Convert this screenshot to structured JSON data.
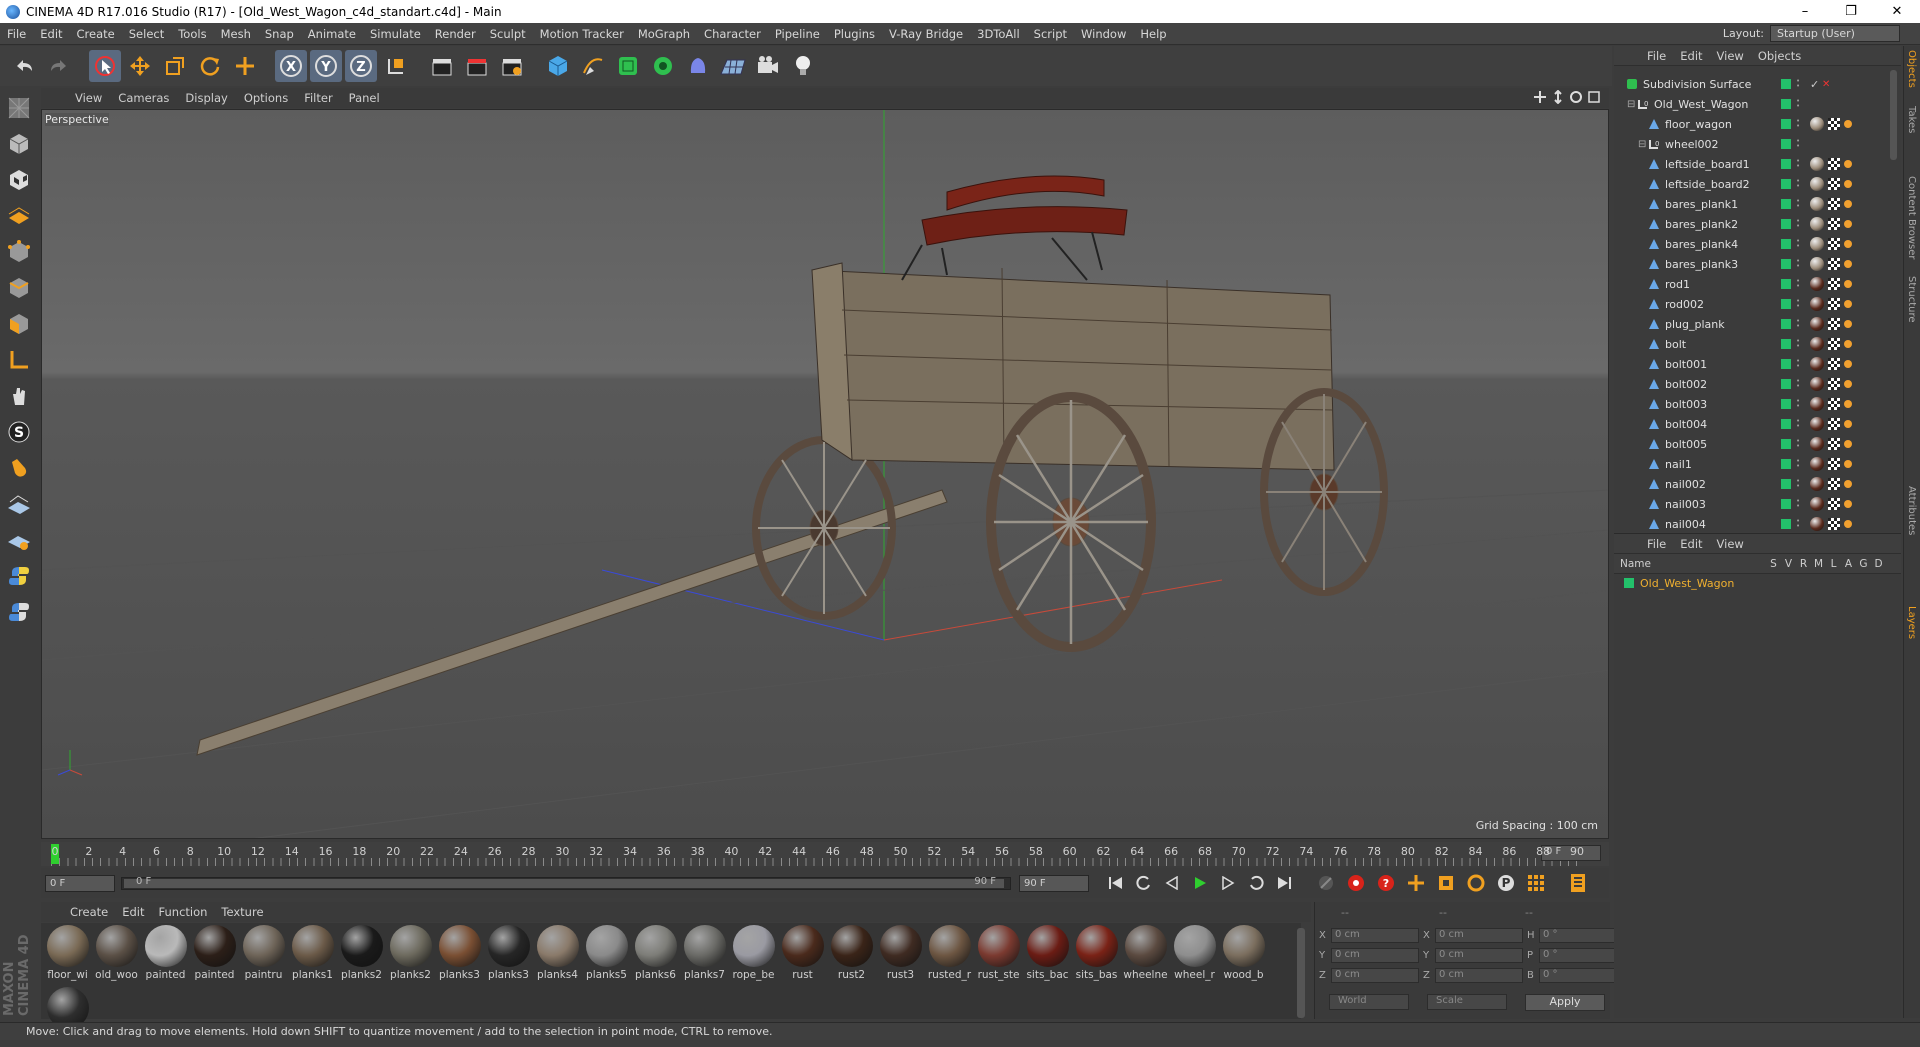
{
  "window": {
    "title": "CINEMA 4D R17.016 Studio (R17) - [Old_West_Wagon_c4d_standart.c4d] - Main",
    "minimize": "–",
    "restore": "❐",
    "close": "✕"
  },
  "menu": [
    "File",
    "Edit",
    "Create",
    "Select",
    "Tools",
    "Mesh",
    "Snap",
    "Animate",
    "Simulate",
    "Render",
    "Sculpt",
    "Motion Tracker",
    "MoGraph",
    "Character",
    "Pipeline",
    "Plugins",
    "V-Ray Bridge",
    "3DToAll",
    "Script",
    "Window",
    "Help"
  ],
  "layout": {
    "label": "Layout:",
    "value": "Startup (User)"
  },
  "viewport": {
    "menu": [
      "View",
      "Cameras",
      "Display",
      "Options",
      "Filter",
      "Panel"
    ],
    "label": "Perspective",
    "grid_spacing": "Grid Spacing : 100 cm"
  },
  "timeline": {
    "ticks": [
      "0",
      "2",
      "4",
      "6",
      "8",
      "10",
      "12",
      "14",
      "16",
      "18",
      "20",
      "22",
      "24",
      "26",
      "28",
      "30",
      "32",
      "34",
      "36",
      "38",
      "40",
      "42",
      "44",
      "46",
      "48",
      "50",
      "52",
      "54",
      "56",
      "58",
      "60",
      "62",
      "64",
      "66",
      "68",
      "70",
      "72",
      "74",
      "76",
      "78",
      "80",
      "82",
      "84",
      "86",
      "88",
      "90"
    ],
    "current_frame": "0 F",
    "start_field": "0 F",
    "range_start": "0 F",
    "range_end": "90 F",
    "end_field": "90 F"
  },
  "material_manager": {
    "menu": [
      "Create",
      "Edit",
      "Function",
      "Texture"
    ],
    "materials": [
      {
        "label": "floor_wi",
        "color": "#7a6a55"
      },
      {
        "label": "old_woo",
        "color": "#5b5046"
      },
      {
        "label": "painted",
        "color": "#b9b9b9"
      },
      {
        "label": "painted",
        "color": "#2c1f18"
      },
      {
        "label": "paintru",
        "color": "#6e6458"
      },
      {
        "label": "planks1",
        "color": "#6b5a48"
      },
      {
        "label": "planks2",
        "color": "#1a1a1a"
      },
      {
        "label": "planks2",
        "color": "#6d6a5e"
      },
      {
        "label": "planks3",
        "color": "#7a4f33"
      },
      {
        "label": "planks3",
        "color": "#262626"
      },
      {
        "label": "planks4",
        "color": "#8a7a6a"
      },
      {
        "label": "planks5",
        "color": "#8a8a8a"
      },
      {
        "label": "planks6",
        "color": "#7d7d78"
      },
      {
        "label": "planks7",
        "color": "#6a6a66"
      },
      {
        "label": "rope_be",
        "color": "#9a9aa2"
      },
      {
        "label": "rust",
        "color": "#4a2a1c"
      },
      {
        "label": "rust2",
        "color": "#3a2418"
      },
      {
        "label": "rust3",
        "color": "#3f2b22"
      },
      {
        "label": "rusted_r",
        "color": "#6d5642"
      },
      {
        "label": "rust_ste",
        "color": "#7b3a30"
      },
      {
        "label": "sits_bac",
        "color": "#6b1c14"
      },
      {
        "label": "sits_bas",
        "color": "#7a2216"
      },
      {
        "label": "wheelne",
        "color": "#5b4a40"
      },
      {
        "label": "wheel_r",
        "color": "#8e8e8e"
      },
      {
        "label": "wood_b",
        "color": "#7b6e5e"
      },
      {
        "label": "",
        "color": "#2e2e2e"
      }
    ]
  },
  "coords": {
    "rows": [
      {
        "a": "X",
        "av": "0 cm",
        "b": "X",
        "bv": "0 cm",
        "c": "H",
        "cv": "0 °"
      },
      {
        "a": "Y",
        "av": "0 cm",
        "b": "Y",
        "bv": "0 cm",
        "c": "P",
        "cv": "0 °"
      },
      {
        "a": "Z",
        "av": "0 cm",
        "b": "Z",
        "bv": "0 cm",
        "c": "B",
        "cv": "0 °"
      }
    ],
    "top_a": "--",
    "top_b": "--",
    "top_c": "--",
    "world": "World",
    "scale": "Scale",
    "apply": "Apply"
  },
  "status": "Move: Click and drag to move elements. Hold down SHIFT to quantize movement / add to the selection in point mode, CTRL to remove.",
  "object_manager": {
    "menu": [
      "File",
      "Edit",
      "View",
      "Objects"
    ],
    "objects": [
      {
        "name": "Subdivision Surface",
        "depth": 0,
        "kind": "subdiv"
      },
      {
        "name": "Old_West_Wagon",
        "depth": 1,
        "kind": "null"
      },
      {
        "name": "floor_wagon",
        "depth": 2,
        "kind": "mesh"
      },
      {
        "name": "wheel002",
        "depth": 2,
        "kind": "null"
      },
      {
        "name": "leftside_board1",
        "depth": 2,
        "kind": "mesh"
      },
      {
        "name": "leftside_board2",
        "depth": 2,
        "kind": "mesh"
      },
      {
        "name": "bares_plank1",
        "depth": 2,
        "kind": "mesh"
      },
      {
        "name": "bares_plank2",
        "depth": 2,
        "kind": "mesh"
      },
      {
        "name": "bares_plank4",
        "depth": 2,
        "kind": "mesh"
      },
      {
        "name": "bares_plank3",
        "depth": 2,
        "kind": "mesh"
      },
      {
        "name": "rod1",
        "depth": 2,
        "kind": "mesh"
      },
      {
        "name": "rod002",
        "depth": 2,
        "kind": "mesh"
      },
      {
        "name": "plug_plank",
        "depth": 2,
        "kind": "mesh"
      },
      {
        "name": "bolt",
        "depth": 2,
        "kind": "mesh"
      },
      {
        "name": "bolt001",
        "depth": 2,
        "kind": "mesh"
      },
      {
        "name": "bolt002",
        "depth": 2,
        "kind": "mesh"
      },
      {
        "name": "bolt003",
        "depth": 2,
        "kind": "mesh"
      },
      {
        "name": "bolt004",
        "depth": 2,
        "kind": "mesh"
      },
      {
        "name": "bolt005",
        "depth": 2,
        "kind": "mesh"
      },
      {
        "name": "nail1",
        "depth": 2,
        "kind": "mesh"
      },
      {
        "name": "nail002",
        "depth": 2,
        "kind": "mesh"
      },
      {
        "name": "nail003",
        "depth": 2,
        "kind": "mesh"
      },
      {
        "name": "nail004",
        "depth": 2,
        "kind": "mesh"
      }
    ]
  },
  "layer_manager": {
    "menu": [
      "File",
      "Edit",
      "View"
    ],
    "columns": [
      "Name",
      "S",
      "V",
      "R",
      "M",
      "L",
      "A",
      "G",
      "D"
    ],
    "layer": {
      "name": "Old_West_Wagon",
      "color": "#23c16b"
    }
  },
  "side_tabs": [
    "Objects",
    "Takes",
    "Content Browser",
    "Structure",
    "Attributes",
    "Layers"
  ],
  "brand": "MAXON CINEMA 4D"
}
